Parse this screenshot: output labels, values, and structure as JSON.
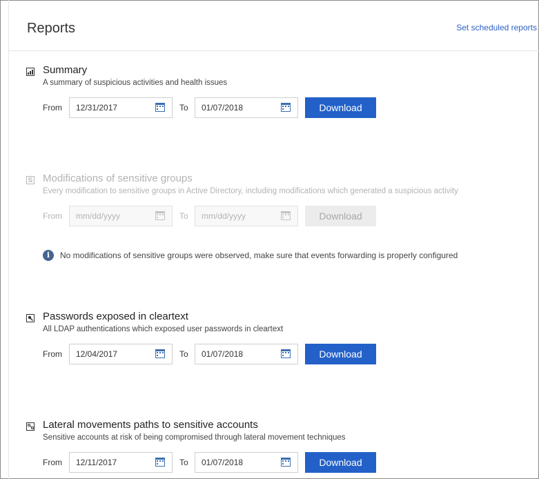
{
  "header": {
    "title": "Reports",
    "scheduled_link": "Set scheduled reports"
  },
  "sections": [
    {
      "title": "Summary",
      "description": "A summary of suspicious activities and health issues",
      "icon": "bar-chart-icon",
      "enabled": true,
      "from_label": "From",
      "from_value": "12/31/2017",
      "to_label": "To",
      "to_value": "01/07/2018",
      "button": "Download"
    },
    {
      "title": "Modifications of sensitive groups",
      "description": "Every modification to sensitive groups in Active Directory, including modifications which generated a suspicious activity",
      "icon": "s-letter-icon",
      "icon_glyph": "S",
      "enabled": false,
      "from_label": "From",
      "from_placeholder": "mm/dd/yyyy",
      "to_label": "To",
      "to_placeholder": "mm/dd/yyyy",
      "button": "Download",
      "info": "No modifications of sensitive groups were observed, make sure that events forwarding is properly configured",
      "info_glyph": "i"
    },
    {
      "title": "Passwords exposed in cleartext",
      "description": "All LDAP authentications which exposed user passwords in cleartext",
      "icon": "key-icon",
      "enabled": true,
      "from_label": "From",
      "from_value": "12/04/2017",
      "to_label": "To",
      "to_value": "01/07/2018",
      "button": "Download"
    },
    {
      "title": "Lateral movements paths to sensitive accounts",
      "description": "Sensitive accounts at risk of being compromised through lateral movement techniques",
      "icon": "path-icon",
      "enabled": true,
      "from_label": "From",
      "from_value": "12/11/2017",
      "to_label": "To",
      "to_value": "01/07/2018",
      "button": "Download"
    }
  ],
  "colors": {
    "accent": "#2361c9",
    "link": "#2b5fc4",
    "info": "#45658f"
  }
}
